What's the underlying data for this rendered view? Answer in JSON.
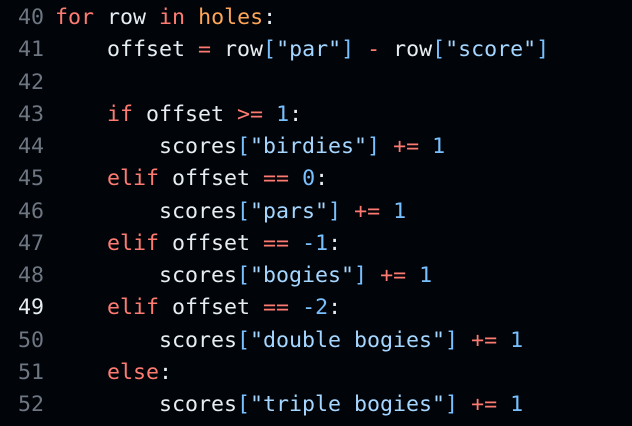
{
  "editor": {
    "active_line": 49,
    "lines": [
      {
        "n": "40",
        "indent": 1,
        "tokens": [
          [
            "kw",
            "for"
          ],
          [
            "pl",
            " row "
          ],
          [
            "kw",
            "in"
          ],
          [
            "pl",
            " "
          ],
          [
            "fn",
            "holes"
          ],
          [
            "pl",
            ":"
          ]
        ]
      },
      {
        "n": "41",
        "indent": 2,
        "tokens": [
          [
            "pl",
            "offset "
          ],
          [
            "op",
            "="
          ],
          [
            "pl",
            " row"
          ],
          [
            "br",
            "["
          ],
          [
            "str",
            "\"par\""
          ],
          [
            "br",
            "]"
          ],
          [
            "pl",
            " "
          ],
          [
            "op",
            "-"
          ],
          [
            "pl",
            " row"
          ],
          [
            "br",
            "["
          ],
          [
            "str",
            "\"score\""
          ],
          [
            "br",
            "]"
          ]
        ]
      },
      {
        "n": "42",
        "indent": 0,
        "tokens": []
      },
      {
        "n": "43",
        "indent": 2,
        "tokens": [
          [
            "kw",
            "if"
          ],
          [
            "pl",
            " offset "
          ],
          [
            "op",
            ">="
          ],
          [
            "pl",
            " "
          ],
          [
            "num",
            "1"
          ],
          [
            "pl",
            ":"
          ]
        ]
      },
      {
        "n": "44",
        "indent": 3,
        "tokens": [
          [
            "pl",
            "scores"
          ],
          [
            "br",
            "["
          ],
          [
            "str",
            "\"birdies\""
          ],
          [
            "br",
            "]"
          ],
          [
            "pl",
            " "
          ],
          [
            "op",
            "+="
          ],
          [
            "pl",
            " "
          ],
          [
            "num",
            "1"
          ]
        ]
      },
      {
        "n": "45",
        "indent": 2,
        "tokens": [
          [
            "kw",
            "elif"
          ],
          [
            "pl",
            " offset "
          ],
          [
            "op",
            "=="
          ],
          [
            "pl",
            " "
          ],
          [
            "num",
            "0"
          ],
          [
            "pl",
            ":"
          ]
        ]
      },
      {
        "n": "46",
        "indent": 3,
        "tokens": [
          [
            "pl",
            "scores"
          ],
          [
            "br",
            "["
          ],
          [
            "str",
            "\"pars\""
          ],
          [
            "br",
            "]"
          ],
          [
            "pl",
            " "
          ],
          [
            "op",
            "+="
          ],
          [
            "pl",
            " "
          ],
          [
            "num",
            "1"
          ]
        ]
      },
      {
        "n": "47",
        "indent": 2,
        "tokens": [
          [
            "kw",
            "elif"
          ],
          [
            "pl",
            " offset "
          ],
          [
            "op",
            "=="
          ],
          [
            "pl",
            " "
          ],
          [
            "num",
            "-1"
          ],
          [
            "pl",
            ":"
          ]
        ]
      },
      {
        "n": "48",
        "indent": 3,
        "tokens": [
          [
            "pl",
            "scores"
          ],
          [
            "br",
            "["
          ],
          [
            "str",
            "\"bogies\""
          ],
          [
            "br",
            "]"
          ],
          [
            "pl",
            " "
          ],
          [
            "op",
            "+="
          ],
          [
            "pl",
            " "
          ],
          [
            "num",
            "1"
          ]
        ]
      },
      {
        "n": "49",
        "indent": 2,
        "tokens": [
          [
            "kw",
            "elif"
          ],
          [
            "pl",
            " offset "
          ],
          [
            "op",
            "=="
          ],
          [
            "pl",
            " "
          ],
          [
            "num",
            "-2"
          ],
          [
            "pl",
            ":"
          ]
        ]
      },
      {
        "n": "50",
        "indent": 3,
        "tokens": [
          [
            "pl",
            "scores"
          ],
          [
            "br",
            "["
          ],
          [
            "str",
            "\"double bogies\""
          ],
          [
            "br",
            "]"
          ],
          [
            "pl",
            " "
          ],
          [
            "op",
            "+="
          ],
          [
            "pl",
            " "
          ],
          [
            "num",
            "1"
          ]
        ]
      },
      {
        "n": "51",
        "indent": 2,
        "tokens": [
          [
            "kw",
            "else"
          ],
          [
            "pl",
            ":"
          ]
        ]
      },
      {
        "n": "52",
        "indent": 3,
        "tokens": [
          [
            "pl",
            "scores"
          ],
          [
            "br",
            "["
          ],
          [
            "str",
            "\"triple bogies\""
          ],
          [
            "br",
            "]"
          ],
          [
            "pl",
            " "
          ],
          [
            "op",
            "+="
          ],
          [
            "pl",
            " "
          ],
          [
            "num",
            "1"
          ]
        ]
      }
    ]
  }
}
